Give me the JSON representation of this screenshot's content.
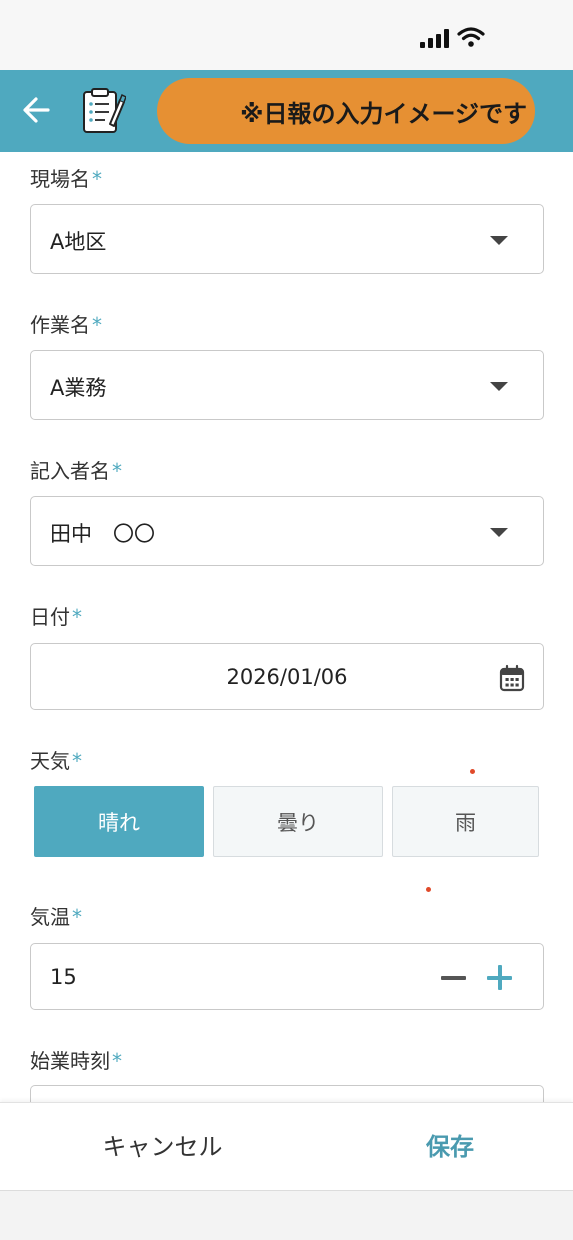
{
  "header": {
    "banner_text": "※日報の入力イメージです"
  },
  "fields": {
    "site": {
      "label": "現場名",
      "required_mark": "*",
      "value": "A地区"
    },
    "task": {
      "label": "作業名",
      "required_mark": "*",
      "value": "A業務"
    },
    "author": {
      "label": "記入者名",
      "required_mark": "*",
      "value": "田中　〇〇"
    },
    "date": {
      "label": "日付",
      "required_mark": "*",
      "value": "2026/01/06"
    },
    "weather": {
      "label": "天気",
      "required_mark": "*",
      "options": [
        "晴れ",
        "曇り",
        "雨"
      ],
      "selected": "晴れ"
    },
    "temperature": {
      "label": "気温",
      "required_mark": "*",
      "value": "15"
    },
    "start_time": {
      "label": "始業時刻",
      "required_mark": "*"
    }
  },
  "footer": {
    "cancel_label": "キャンセル",
    "save_label": "保存"
  },
  "colors": {
    "accent": "#4fa9bf",
    "banner": "#e69033",
    "save_text": "#4a9aaf"
  },
  "icons": {
    "back": "arrow-left-icon",
    "report": "report-pen-icon",
    "dropdown": "caret-down-icon",
    "calendar": "calendar-icon",
    "signal": "cellular-signal-icon",
    "wifi": "wifi-icon"
  }
}
